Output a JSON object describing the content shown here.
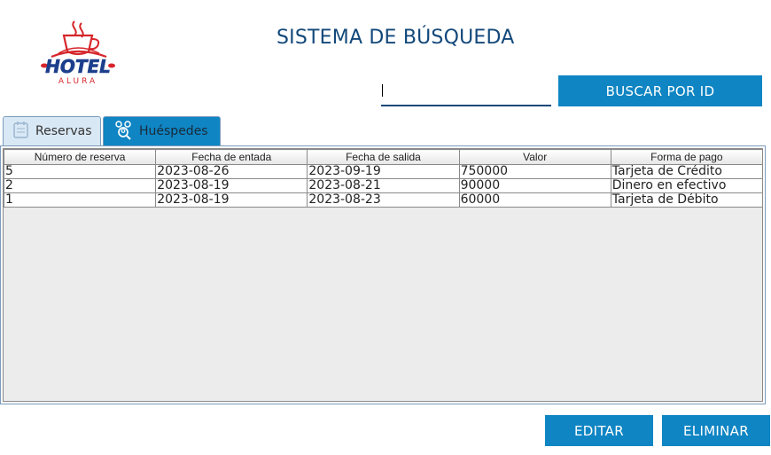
{
  "logo": {
    "text": "HOTEL",
    "subtext": "ALURA"
  },
  "header": {
    "title": "SISTEMA DE BÚSQUEDA"
  },
  "search": {
    "value": "",
    "button_label": "BUSCAR POR ID"
  },
  "tabs": [
    {
      "label": "Reservas",
      "icon": "calendar-icon",
      "selected": true
    },
    {
      "label": "Huéspedes",
      "icon": "guests-icon",
      "selected": false
    }
  ],
  "table": {
    "columns": [
      "Número de reserva",
      "Fecha de entada",
      "Fecha de salida",
      "Valor",
      "Forma de pago"
    ],
    "rows": [
      [
        "5",
        "2023-08-26",
        "2023-09-19",
        "750000",
        "Tarjeta de Crédito"
      ],
      [
        "2",
        "2023-08-19",
        "2023-08-21",
        "90000",
        "Dinero en efectivo"
      ],
      [
        "1",
        "2023-08-19",
        "2023-08-23",
        "60000",
        "Tarjeta de Débito"
      ]
    ]
  },
  "actions": {
    "edit_label": "EDITAR",
    "delete_label": "ELIMINAR"
  },
  "colors": {
    "accent": "#0f85c3",
    "title": "#12487a",
    "logo_red": "#d6262b",
    "logo_blue": "#1c3f8c"
  }
}
